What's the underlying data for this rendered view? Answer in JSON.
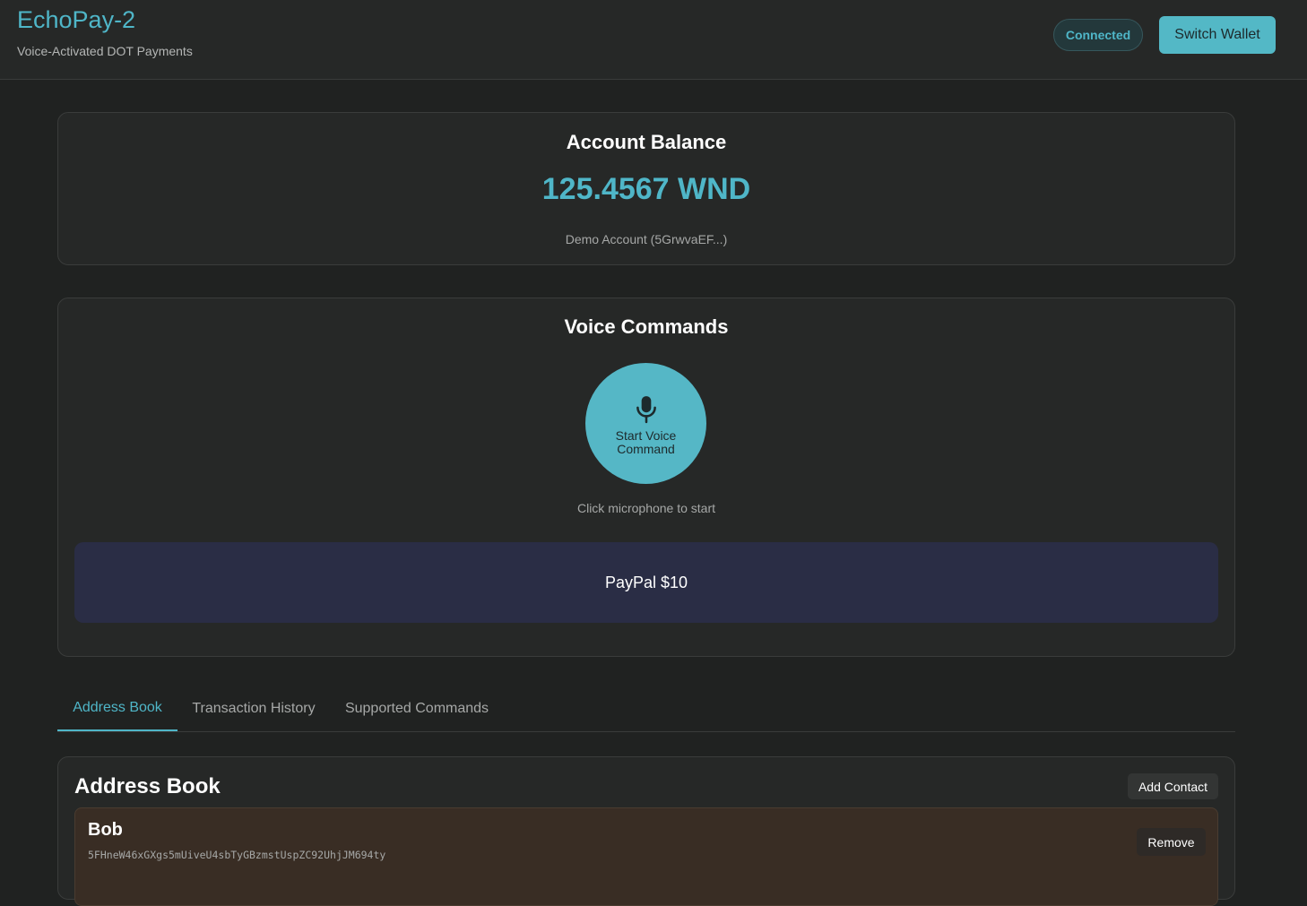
{
  "header": {
    "title": "EchoPay-2",
    "subtitle": "Voice-Activated DOT Payments",
    "status": "Connected",
    "switch_wallet": "Switch Wallet"
  },
  "balance": {
    "title": "Account Balance",
    "amount": "125.4567 WND",
    "account": "Demo Account (5GrwvaEF...)"
  },
  "voice": {
    "title": "Voice Commands",
    "mic_label": "Start Voice Command",
    "hint": "Click microphone to start",
    "transcript": "PayPal $10"
  },
  "tabs": [
    {
      "label": "Address Book",
      "active": true
    },
    {
      "label": "Transaction History",
      "active": false
    },
    {
      "label": "Supported Commands",
      "active": false
    }
  ],
  "address_book": {
    "title": "Address Book",
    "add_contact": "Add Contact",
    "contacts": [
      {
        "name": "Bob",
        "address": "5FHneW46xGXgs5mUiveU4sbTyGBzmstUspZC92UhjJM694ty",
        "remove": "Remove"
      }
    ]
  },
  "colors": {
    "accent": "#4fb6c8",
    "background": "#202221",
    "card": "#262827",
    "transcript_bg": "#2a2d45",
    "contact_bg": "#392d24"
  }
}
